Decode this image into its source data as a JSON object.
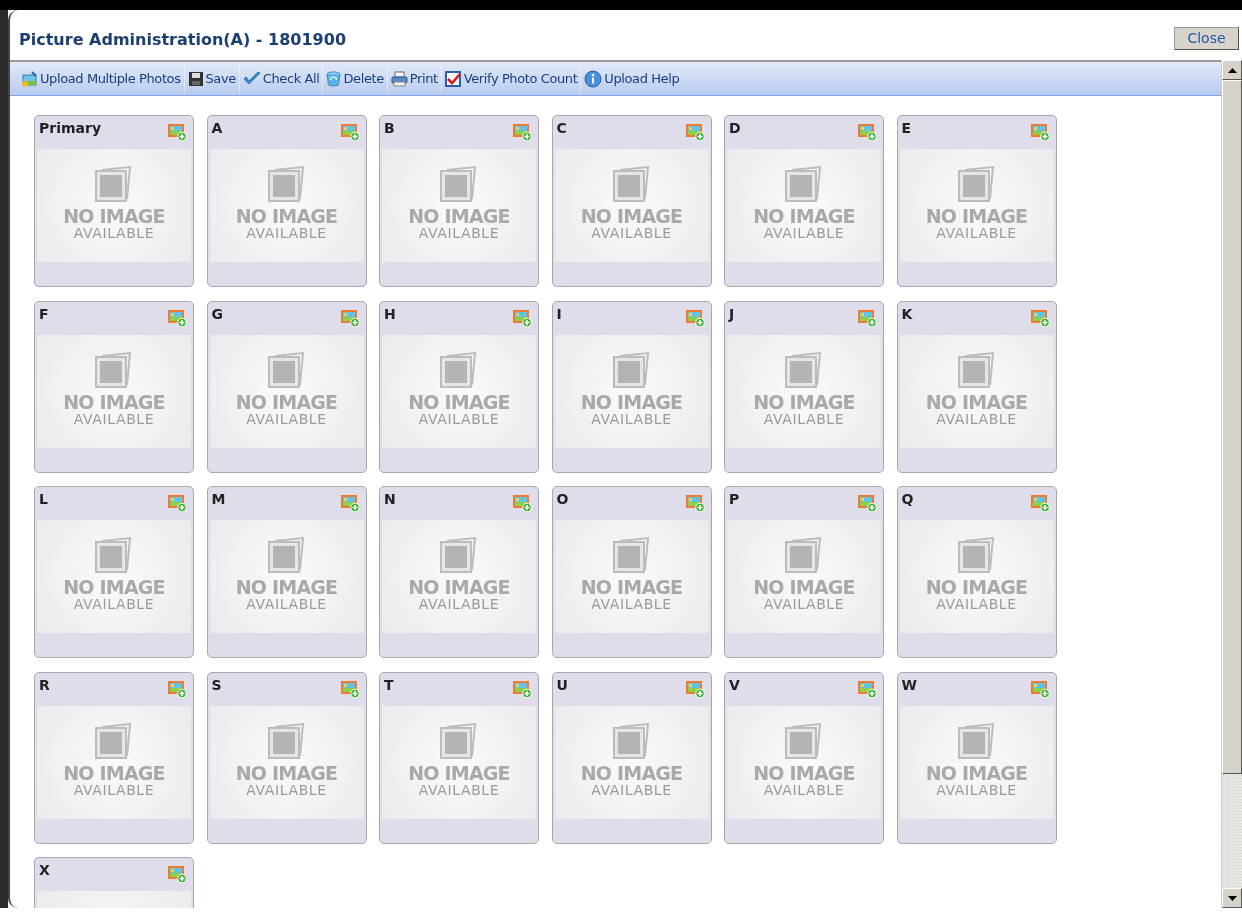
{
  "window": {
    "title": "Picture Administration(A) - 1801900",
    "close_button": "Close"
  },
  "toolbar": [
    {
      "kind": "upload",
      "label": "Upload Multiple Photos"
    },
    {
      "kind": "save",
      "label": "Save"
    },
    {
      "kind": "check",
      "label": "Check All"
    },
    {
      "kind": "delete",
      "label": "Delete"
    },
    {
      "kind": "print",
      "label": "Print"
    },
    {
      "kind": "verify",
      "label": "Verify Photo Count"
    },
    {
      "kind": "help",
      "label": "Upload Help"
    }
  ],
  "photo_slots": [
    {
      "label": "Primary",
      "caption_1": "NO IMAGE",
      "caption_2": "AVAILABLE"
    },
    {
      "label": "A",
      "caption_1": "NO IMAGE",
      "caption_2": "AVAILABLE"
    },
    {
      "label": "B",
      "caption_1": "NO IMAGE",
      "caption_2": "AVAILABLE"
    },
    {
      "label": "C",
      "caption_1": "NO IMAGE",
      "caption_2": "AVAILABLE"
    },
    {
      "label": "D",
      "caption_1": "NO IMAGE",
      "caption_2": "AVAILABLE"
    },
    {
      "label": "E",
      "caption_1": "NO IMAGE",
      "caption_2": "AVAILABLE"
    },
    {
      "label": "F",
      "caption_1": "NO IMAGE",
      "caption_2": "AVAILABLE"
    },
    {
      "label": "G",
      "caption_1": "NO IMAGE",
      "caption_2": "AVAILABLE"
    },
    {
      "label": "H",
      "caption_1": "NO IMAGE",
      "caption_2": "AVAILABLE"
    },
    {
      "label": "I",
      "caption_1": "NO IMAGE",
      "caption_2": "AVAILABLE"
    },
    {
      "label": "J",
      "caption_1": "NO IMAGE",
      "caption_2": "AVAILABLE"
    },
    {
      "label": "K",
      "caption_1": "NO IMAGE",
      "caption_2": "AVAILABLE"
    },
    {
      "label": "L",
      "caption_1": "NO IMAGE",
      "caption_2": "AVAILABLE"
    },
    {
      "label": "M",
      "caption_1": "NO IMAGE",
      "caption_2": "AVAILABLE"
    },
    {
      "label": "N",
      "caption_1": "NO IMAGE",
      "caption_2": "AVAILABLE"
    },
    {
      "label": "O",
      "caption_1": "NO IMAGE",
      "caption_2": "AVAILABLE"
    },
    {
      "label": "P",
      "caption_1": "NO IMAGE",
      "caption_2": "AVAILABLE"
    },
    {
      "label": "Q",
      "caption_1": "NO IMAGE",
      "caption_2": "AVAILABLE"
    },
    {
      "label": "R",
      "caption_1": "NO IMAGE",
      "caption_2": "AVAILABLE"
    },
    {
      "label": "S",
      "caption_1": "NO IMAGE",
      "caption_2": "AVAILABLE"
    },
    {
      "label": "T",
      "caption_1": "NO IMAGE",
      "caption_2": "AVAILABLE"
    },
    {
      "label": "U",
      "caption_1": "NO IMAGE",
      "caption_2": "AVAILABLE"
    },
    {
      "label": "V",
      "caption_1": "NO IMAGE",
      "caption_2": "AVAILABLE"
    },
    {
      "label": "W",
      "caption_1": "NO IMAGE",
      "caption_2": "AVAILABLE"
    },
    {
      "label": "X"
    }
  ]
}
